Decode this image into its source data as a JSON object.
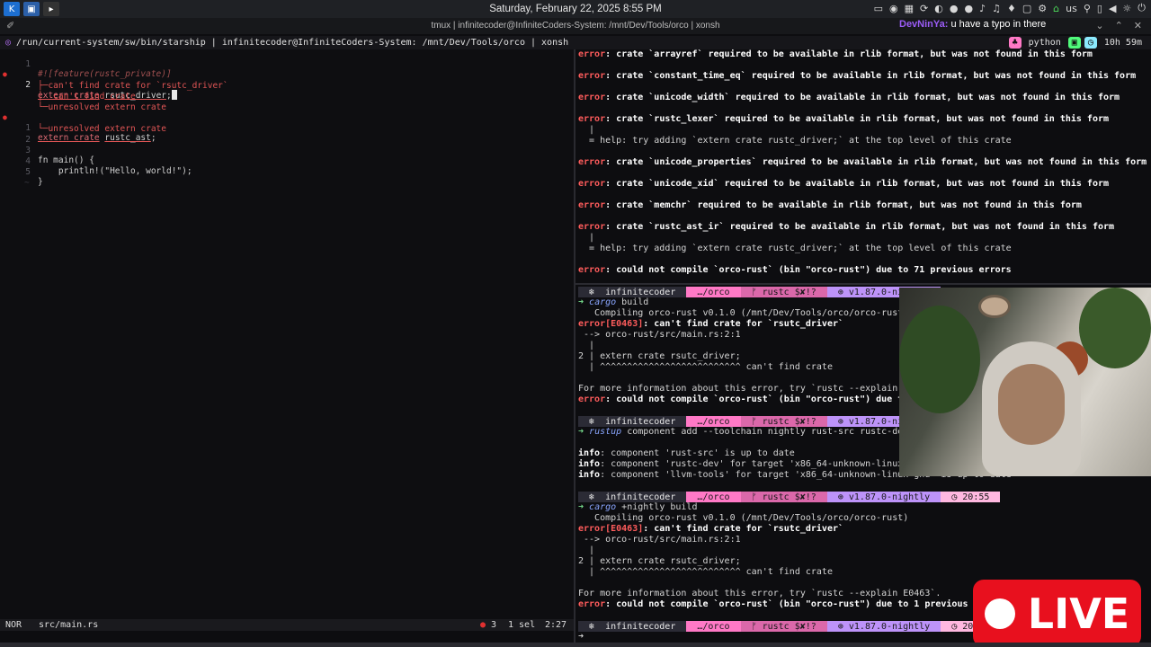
{
  "panel": {
    "clock": "Saturday, February 22, 2025 8:55 PM",
    "keyboard_layout": "us",
    "launchers": [
      "kde-icon",
      "dolphin-icon",
      "konsole-icon"
    ]
  },
  "window": {
    "title": "tmux | infinitecoder@InfiniteCoders-System: /mnt/Dev/Tools/orco | xonsh"
  },
  "chat_overlay": {
    "user": "DevNinYa:",
    "message": " u have a typo in there"
  },
  "prompt": {
    "path_line": "/run/current-system/sw/bin/starship | infinitecoder@InfiniteCoders-System: /mnt/Dev/Tools/orco | xonsh",
    "lang": "python",
    "duration": "10h 59m"
  },
  "editor": {
    "lines": [
      {
        "num": "1",
        "text": "#![feature(rustc_private)]"
      },
      {
        "num": "2",
        "kw": "extern crate",
        "name": "rsutc_driver",
        "semi": ";"
      },
      {
        "diag": "├─can't find crate for `rsutc_driver`"
      },
      {
        "diag": "│  can't find crate"
      },
      {
        "diag": "└─unresolved extern crate"
      },
      {
        "num": "1",
        "kw": "extern crate",
        "name": "rustc_ast",
        "semi": ";"
      },
      {
        "diag": "└─unresolved extern crate"
      },
      {
        "num": "2",
        "text": ""
      },
      {
        "num": "3",
        "text": "fn main() {"
      },
      {
        "num": "4",
        "text": "    println!(\"Hello, world!\");"
      },
      {
        "num": "5",
        "text": "}"
      },
      {
        "num": "",
        "text": "~"
      }
    ],
    "status": {
      "mode": "NOR",
      "file": "src/main.rs",
      "errors": "3",
      "sel": "1 sel",
      "pos": "2:27"
    }
  },
  "terminal": {
    "errors_top": [
      {
        "pre": "error",
        "msg": ": crate `arrayref` required to be available in rlib format, but was not found in this form"
      },
      {
        "pre": "error",
        "msg": ": crate `constant_time_eq` required to be available in rlib format, but was not found in this form"
      },
      {
        "pre": "error",
        "msg": ": crate `unicode_width` required to be available in rlib format, but was not found in this form"
      },
      {
        "pre": "error",
        "msg": ": crate `rustc_lexer` required to be available in rlib format, but was not found in this form"
      },
      {
        "pre": "",
        "msg": "  |"
      },
      {
        "pre": "",
        "msg": "  = help: try adding `extern crate rustc_driver;` at the top level of this crate"
      },
      {
        "pre": "error",
        "msg": ": crate `unicode_properties` required to be available in rlib format, but was not found in this form"
      },
      {
        "pre": "error",
        "msg": ": crate `unicode_xid` required to be available in rlib format, but was not found in this form"
      },
      {
        "pre": "error",
        "msg": ": crate `memchr` required to be available in rlib format, but was not found in this form"
      },
      {
        "pre": "error",
        "msg": ": crate `rustc_ast_ir` required to be available in rlib format, but was not found in this form"
      },
      {
        "pre": "",
        "msg": "  |"
      },
      {
        "pre": "",
        "msg": "  = help: try adding `extern crate rustc_driver;` at the top level of this crate"
      },
      {
        "pre": "error",
        "msg": ": could not compile `orco-rust` (bin \"orco-rust\") due to 71 previous errors"
      }
    ],
    "prompt_segments": {
      "user": " ❄  infinitecoder ",
      "dir": " …/orco ",
      "git": " ᚠ rustc $✘!? ",
      "ver": " ⊕ v1.87.0-nightly ",
      "time": " ◷ 20:55 "
    },
    "block1": {
      "cmd_prog": "cargo",
      "cmd_args": " build",
      "compiling": "   Compiling orco-rust v0.1.0 (/mnt/Dev/Tools/orco/orco-rust)",
      "e0463": "error[E0463]",
      "e0463_msg": ": can't find crate for `rsutc_driver`",
      "arrow": " --> orco-rust/src/main.rs:2:1",
      "bar": "  |",
      "src": "2 | extern crate rsutc_driver;",
      "carets": "  | ^^^^^^^^^^^^^^^^^^^^^^^^^^ can't find crate",
      "more": "For more information about this error, try `rustc --explain E0463`.",
      "final": ": could not compile `orco-rust` (bin \"orco-rust\") due to 1 previous error"
    },
    "block2": {
      "cmd_prog": "rustup",
      "cmd_args": " component add --toolchain nightly rust-src rustc-dev llvm-tools",
      "info1": ": component 'rust-src' is up to date",
      "info2": ": component 'rustc-dev' for target 'x86_64-unknown-linux-gnu' is up to date",
      "info3": ": component 'llvm-tools' for target 'x86_64-unknown-linux-gnu' is up to date"
    },
    "block3": {
      "cmd_prog": "cargo",
      "cmd_args": " +nightly build"
    }
  },
  "live_badge": "LIVE"
}
